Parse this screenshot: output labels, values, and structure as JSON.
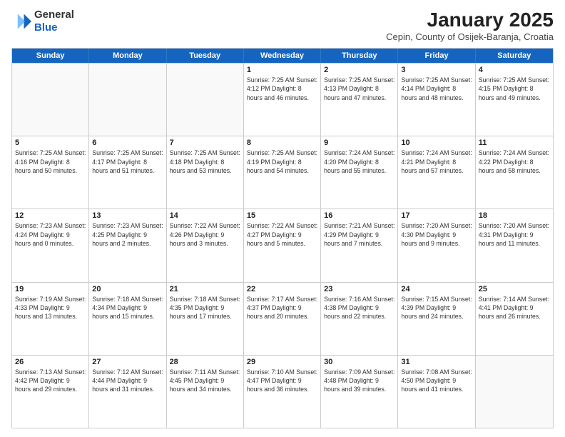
{
  "header": {
    "logo_line1": "General",
    "logo_line2": "Blue",
    "month": "January 2025",
    "location": "Cepin, County of Osijek-Baranja, Croatia"
  },
  "days_of_week": [
    "Sunday",
    "Monday",
    "Tuesday",
    "Wednesday",
    "Thursday",
    "Friday",
    "Saturday"
  ],
  "weeks": [
    [
      {
        "day": "",
        "info": ""
      },
      {
        "day": "",
        "info": ""
      },
      {
        "day": "",
        "info": ""
      },
      {
        "day": "1",
        "info": "Sunrise: 7:25 AM\nSunset: 4:12 PM\nDaylight: 8 hours and 46 minutes."
      },
      {
        "day": "2",
        "info": "Sunrise: 7:25 AM\nSunset: 4:13 PM\nDaylight: 8 hours and 47 minutes."
      },
      {
        "day": "3",
        "info": "Sunrise: 7:25 AM\nSunset: 4:14 PM\nDaylight: 8 hours and 48 minutes."
      },
      {
        "day": "4",
        "info": "Sunrise: 7:25 AM\nSunset: 4:15 PM\nDaylight: 8 hours and 49 minutes."
      }
    ],
    [
      {
        "day": "5",
        "info": "Sunrise: 7:25 AM\nSunset: 4:16 PM\nDaylight: 8 hours and 50 minutes."
      },
      {
        "day": "6",
        "info": "Sunrise: 7:25 AM\nSunset: 4:17 PM\nDaylight: 8 hours and 51 minutes."
      },
      {
        "day": "7",
        "info": "Sunrise: 7:25 AM\nSunset: 4:18 PM\nDaylight: 8 hours and 53 minutes."
      },
      {
        "day": "8",
        "info": "Sunrise: 7:25 AM\nSunset: 4:19 PM\nDaylight: 8 hours and 54 minutes."
      },
      {
        "day": "9",
        "info": "Sunrise: 7:24 AM\nSunset: 4:20 PM\nDaylight: 8 hours and 55 minutes."
      },
      {
        "day": "10",
        "info": "Sunrise: 7:24 AM\nSunset: 4:21 PM\nDaylight: 8 hours and 57 minutes."
      },
      {
        "day": "11",
        "info": "Sunrise: 7:24 AM\nSunset: 4:22 PM\nDaylight: 8 hours and 58 minutes."
      }
    ],
    [
      {
        "day": "12",
        "info": "Sunrise: 7:23 AM\nSunset: 4:24 PM\nDaylight: 9 hours and 0 minutes."
      },
      {
        "day": "13",
        "info": "Sunrise: 7:23 AM\nSunset: 4:25 PM\nDaylight: 9 hours and 2 minutes."
      },
      {
        "day": "14",
        "info": "Sunrise: 7:22 AM\nSunset: 4:26 PM\nDaylight: 9 hours and 3 minutes."
      },
      {
        "day": "15",
        "info": "Sunrise: 7:22 AM\nSunset: 4:27 PM\nDaylight: 9 hours and 5 minutes."
      },
      {
        "day": "16",
        "info": "Sunrise: 7:21 AM\nSunset: 4:29 PM\nDaylight: 9 hours and 7 minutes."
      },
      {
        "day": "17",
        "info": "Sunrise: 7:20 AM\nSunset: 4:30 PM\nDaylight: 9 hours and 9 minutes."
      },
      {
        "day": "18",
        "info": "Sunrise: 7:20 AM\nSunset: 4:31 PM\nDaylight: 9 hours and 11 minutes."
      }
    ],
    [
      {
        "day": "19",
        "info": "Sunrise: 7:19 AM\nSunset: 4:33 PM\nDaylight: 9 hours and 13 minutes."
      },
      {
        "day": "20",
        "info": "Sunrise: 7:18 AM\nSunset: 4:34 PM\nDaylight: 9 hours and 15 minutes."
      },
      {
        "day": "21",
        "info": "Sunrise: 7:18 AM\nSunset: 4:35 PM\nDaylight: 9 hours and 17 minutes."
      },
      {
        "day": "22",
        "info": "Sunrise: 7:17 AM\nSunset: 4:37 PM\nDaylight: 9 hours and 20 minutes."
      },
      {
        "day": "23",
        "info": "Sunrise: 7:16 AM\nSunset: 4:38 PM\nDaylight: 9 hours and 22 minutes."
      },
      {
        "day": "24",
        "info": "Sunrise: 7:15 AM\nSunset: 4:39 PM\nDaylight: 9 hours and 24 minutes."
      },
      {
        "day": "25",
        "info": "Sunrise: 7:14 AM\nSunset: 4:41 PM\nDaylight: 9 hours and 26 minutes."
      }
    ],
    [
      {
        "day": "26",
        "info": "Sunrise: 7:13 AM\nSunset: 4:42 PM\nDaylight: 9 hours and 29 minutes."
      },
      {
        "day": "27",
        "info": "Sunrise: 7:12 AM\nSunset: 4:44 PM\nDaylight: 9 hours and 31 minutes."
      },
      {
        "day": "28",
        "info": "Sunrise: 7:11 AM\nSunset: 4:45 PM\nDaylight: 9 hours and 34 minutes."
      },
      {
        "day": "29",
        "info": "Sunrise: 7:10 AM\nSunset: 4:47 PM\nDaylight: 9 hours and 36 minutes."
      },
      {
        "day": "30",
        "info": "Sunrise: 7:09 AM\nSunset: 4:48 PM\nDaylight: 9 hours and 39 minutes."
      },
      {
        "day": "31",
        "info": "Sunrise: 7:08 AM\nSunset: 4:50 PM\nDaylight: 9 hours and 41 minutes."
      },
      {
        "day": "",
        "info": ""
      }
    ]
  ]
}
